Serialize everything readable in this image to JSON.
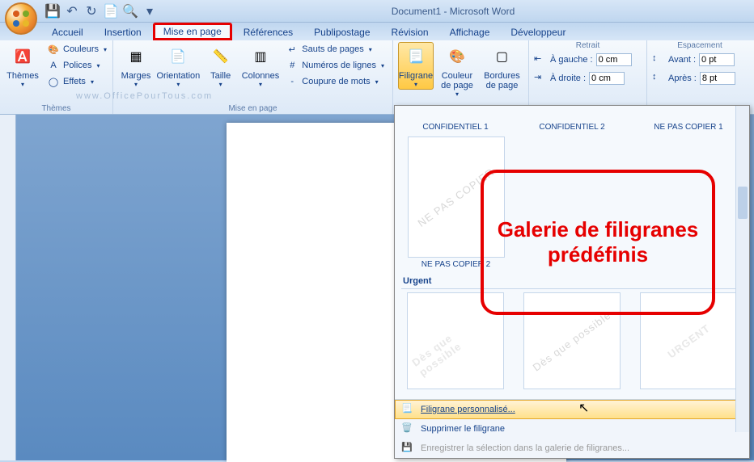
{
  "window_title": "Document1 - Microsoft Word",
  "tabs": {
    "accueil": "Accueil",
    "insertion": "Insertion",
    "mise_en_page": "Mise en page",
    "references": "Références",
    "publipostage": "Publipostage",
    "revision": "Révision",
    "affichage": "Affichage",
    "developpeur": "Développeur"
  },
  "ribbon": {
    "themes": {
      "label": "Thèmes",
      "main": "Thèmes",
      "couleurs": "Couleurs",
      "polices": "Polices",
      "effets": "Effets"
    },
    "page_setup": {
      "label": "Mise en page",
      "marges": "Marges",
      "orientation": "Orientation",
      "taille": "Taille",
      "colonnes": "Colonnes",
      "sauts": "Sauts de pages",
      "numeros": "Numéros de lignes",
      "coupure": "Coupure de mots"
    },
    "background": {
      "filigrane": "Filigrane",
      "couleur_page": "Couleur de page",
      "bordures": "Bordures de page"
    },
    "retrait": {
      "label": "Retrait",
      "gauche_label": "À gauche :",
      "gauche_value": "0 cm",
      "droite_label": "À droite :",
      "droite_value": "0 cm"
    },
    "espacement": {
      "label": "Espacement",
      "avant_label": "Avant :",
      "avant_value": "0 pt",
      "apres_label": "Après :",
      "apres_value": "8 pt"
    }
  },
  "gallery": {
    "row1_captions": [
      "CONFIDENTIEL 1",
      "CONFIDENTIEL 2",
      "NE PAS COPIER 1"
    ],
    "ne_pas_copier_wm": "NE PAS COPIER",
    "ne_pas_copier_caption": "NE PAS COPIER 2",
    "section_urgent": "Urgent",
    "urgent_items": [
      "Dès que possible",
      "Dès que possible",
      "URGENT"
    ],
    "menu_personnalise": "Filigrane personnalisé...",
    "menu_supprimer": "Supprimer le filigrane",
    "menu_enregistrer": "Enregistrer la sélection dans la galerie de filigranes..."
  },
  "annotation": "Galerie de filigranes prédéfinis",
  "watermark_url": "www.OfficePourTous.com"
}
